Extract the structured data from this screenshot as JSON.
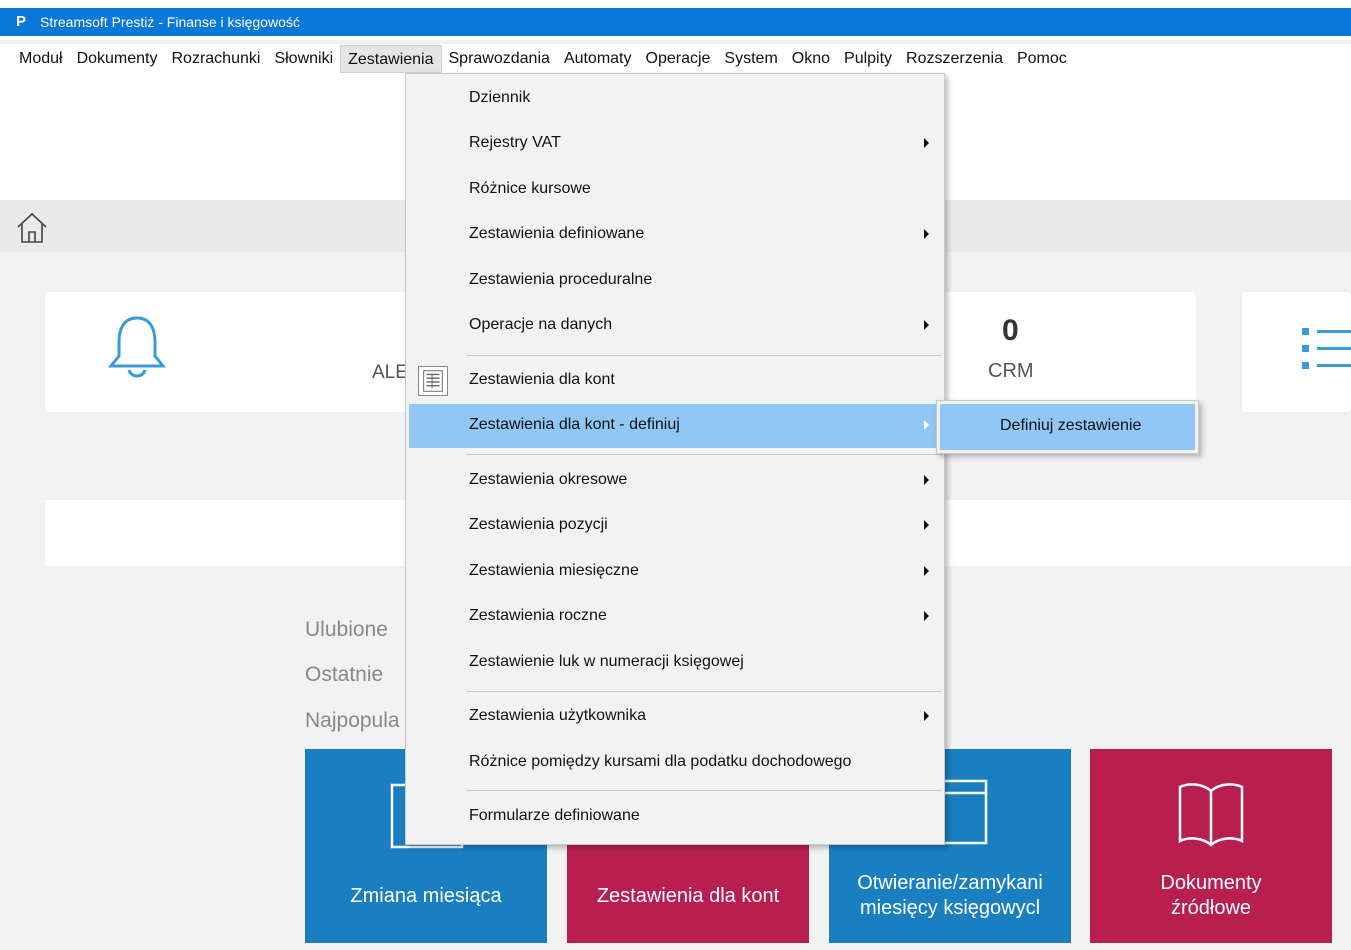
{
  "window": {
    "title": "Streamsoft Prestiż - Finanse i księgowość",
    "logo": "P"
  },
  "menubar": {
    "items": [
      "Moduł",
      "Dokumenty",
      "Rozrachunki",
      "Słowniki",
      "Zestawienia",
      "Sprawozdania",
      "Automaty",
      "Operacje",
      "System",
      "Okno",
      "Pulpity",
      "Rozszerzenia",
      "Pomoc"
    ]
  },
  "dashboard": {
    "alerts_label": "ALE",
    "crm_count": "0",
    "crm_label": "CRM",
    "favorites": "Ulubione",
    "recent": "Ostatnie",
    "popular": "Najpopula"
  },
  "tiles": [
    {
      "label": "Zmiana miesiąca",
      "color": "#1a7fc1"
    },
    {
      "label": "Zestawienia dla kont",
      "color": "#b81e4f"
    },
    {
      "label_line1": "Otwieranie/zamykani",
      "label_line2": "miesięcy księgowycl",
      "color": "#1a7fc1"
    },
    {
      "label_line1": "Dokumenty",
      "label_line2": "źródłowe",
      "color": "#b81e4f"
    }
  ],
  "dropdown": {
    "items": [
      "Dziennik",
      "Rejestry VAT",
      "Różnice kursowe",
      "Zestawienia definiowane",
      "Zestawienia proceduralne",
      "Operacje na danych",
      "Zestawienia dla kont",
      "Zestawienia dla kont - definiuj",
      "Zestawienia okresowe",
      "Zestawienia pozycji",
      "Zestawienia miesięczne",
      "Zestawienia roczne",
      "Zestawienie luk w numeracji księgowej",
      "Zestawienia użytkownika",
      "Różnice pomiędzy kursami dla podatku dochodowego",
      "Formularze definiowane"
    ]
  },
  "submenu": {
    "item": "Definiuj zestawienie"
  },
  "icons": {
    "home": "home-icon",
    "bell": "bell-icon",
    "list": "list-icon",
    "calc": "spreadsheet-icon",
    "book": "book-icon",
    "calendar": "calendar-icon"
  },
  "colors": {
    "title_bar": "#0a78d7",
    "highlight": "#90c7f5",
    "tile_blue": "#1a7fc1",
    "tile_red": "#b81e4f"
  }
}
